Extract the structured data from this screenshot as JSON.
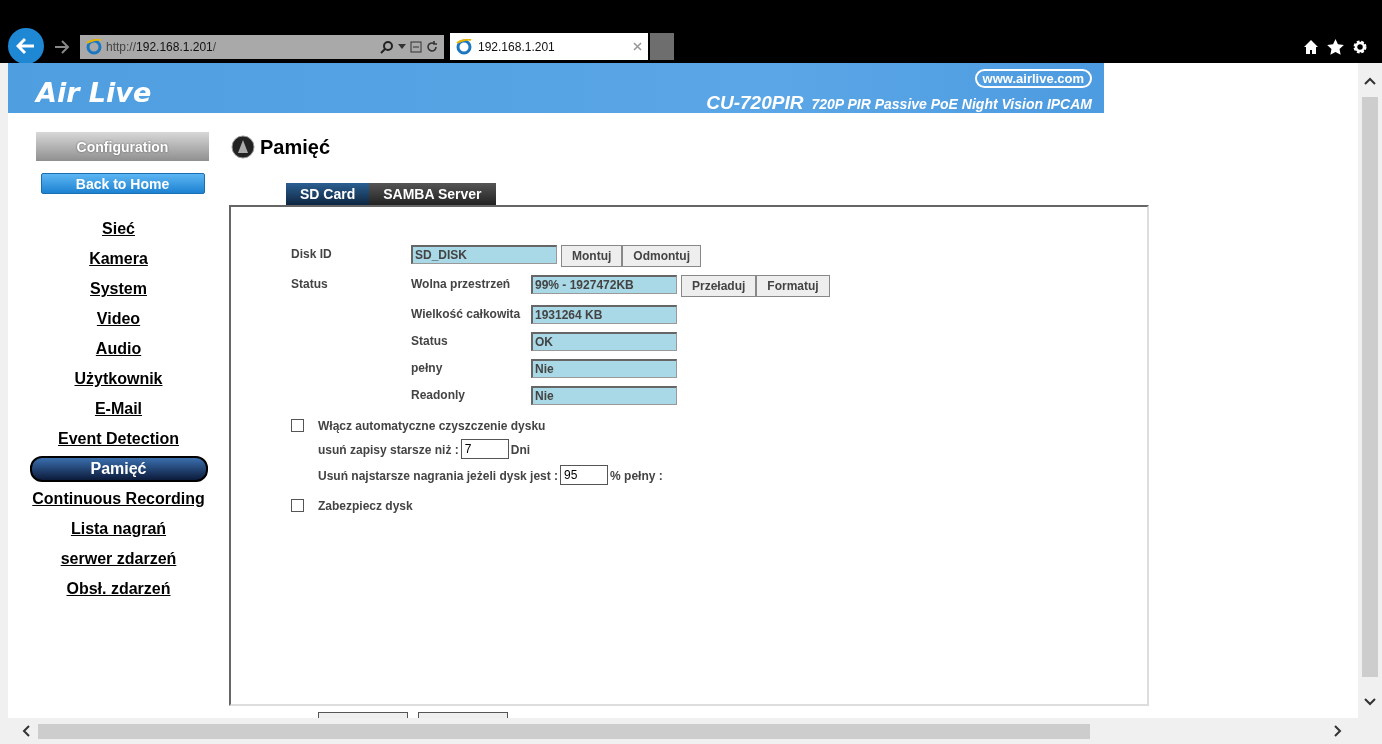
{
  "browser": {
    "url_prefix": "http://",
    "url_host": "192.168.1.201",
    "url_suffix": "/",
    "tab_title": "192.168.1.201"
  },
  "banner": {
    "logo": "Air Live",
    "website": "www.airlive.com",
    "model": "CU-720PIR",
    "description": "720P PIR Passive PoE Night Vision IPCAM"
  },
  "sidebar": {
    "header": "Configuration",
    "home_button": "Back to Home",
    "items": [
      {
        "label": "Sieć",
        "selected": false
      },
      {
        "label": "Kamera",
        "selected": false
      },
      {
        "label": "System",
        "selected": false
      },
      {
        "label": "Video",
        "selected": false
      },
      {
        "label": "Audio",
        "selected": false
      },
      {
        "label": "Użytkownik",
        "selected": false
      },
      {
        "label": "E-Mail",
        "selected": false
      },
      {
        "label": "Event Detection",
        "selected": false
      },
      {
        "label": "Pamięć",
        "selected": true
      },
      {
        "label": "Continuous Recording",
        "selected": false
      },
      {
        "label": "Lista nagrań",
        "selected": false
      },
      {
        "label": "serwer zdarzeń",
        "selected": false
      },
      {
        "label": "Obsł. zdarzeń",
        "selected": false
      }
    ]
  },
  "page_title": "Pamięć",
  "tabs": [
    {
      "label": "SD Card",
      "selected": true
    },
    {
      "label": "SAMBA Server",
      "selected": false
    }
  ],
  "disk_id": {
    "label": "Disk ID",
    "value": "SD_DISK",
    "buttons": [
      "Montuj",
      "Odmontuj"
    ]
  },
  "status": {
    "label": "Status",
    "fields": [
      {
        "label": "Wolna przestrzeń",
        "value": "99% - 1927472KB",
        "buttons": [
          "Przeładuj",
          "Formatuj"
        ]
      },
      {
        "label": "Wielkość całkowita",
        "value": "1931264 KB"
      },
      {
        "label": "Status",
        "value": "OK"
      },
      {
        "label": "pełny",
        "value": "Nie"
      },
      {
        "label": "Readonly",
        "value": "Nie"
      }
    ]
  },
  "auto_clean": {
    "label": "Włącz automatyczne czyszczenie dysku",
    "checked": false,
    "days_label": "usuń zapisy starsze niż :",
    "days_value": "7",
    "days_unit": "Dni",
    "full_label": "Usuń najstarsze nagrania jeżeli dysk jest :",
    "full_value": "95",
    "full_unit": "% pełny :"
  },
  "protect": {
    "label": "Zabezpiecz dysk",
    "checked": false
  }
}
